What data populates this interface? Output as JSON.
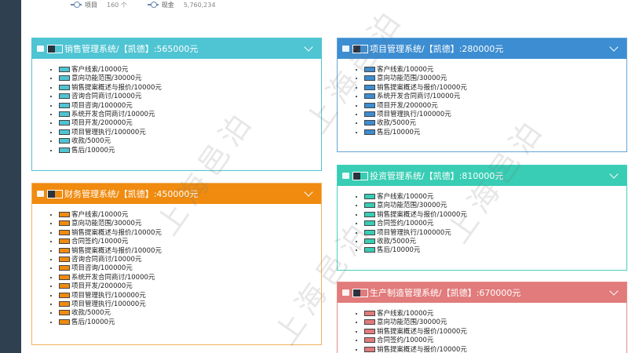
{
  "legend": [
    {
      "label": "项目",
      "value": "160 个"
    },
    {
      "label": "现金",
      "value": "5,760,234"
    }
  ],
  "panels": {
    "sales": {
      "title": "销售管理系统/【凯德】:565000元",
      "color": "#4fc4d3",
      "items": [
        "客户线索/10000元",
        "意向功能范围/30000元",
        "销售提案概述与报价/10000元",
        "咨询合同商讨/10000元",
        "项目咨询/100000元",
        "系统开发合同商讨/10000元",
        "项目开发/200000元",
        "项目管理执行/100000元",
        "收款/5000元",
        "售后/10000元"
      ]
    },
    "project": {
      "title": "项目管理系统/【凯德】:280000元",
      "color": "#3c8dd1",
      "items": [
        "客户线索/10000元",
        "意向功能范围/30000元",
        "销售提案概述与报价/10000元",
        "系统开发合同商讨/10000元",
        "项目开发/200000元",
        "项目管理执行/100000元",
        "收款/5000元",
        "售后/10000元"
      ]
    },
    "finance": {
      "title": "财务管理系统/【凯德】:450000元",
      "color": "#f08b0f",
      "items": [
        "客户线索/10000元",
        "意向功能范围/30000元",
        "销售提案概述与报价/10000元",
        "合同签约/10000元",
        "销售提案概述与报价/10000元",
        "咨询合同商讨/10000元",
        "项目咨询/100000元",
        "系统开发合同商讨/10000元",
        "项目开发/200000元",
        "项目管理执行/100000元",
        "项目管理执行/100000元",
        "收款/5000元",
        "售后/10000元"
      ]
    },
    "purchase": {
      "title": "投资管理系统/【凯德】:810000元",
      "color": "#38cdb4",
      "items": [
        "客户线索/10000元",
        "意向功能范围/30000元",
        "销售提案概述与报价/10000元",
        "合同签约/10000元",
        "项目管理执行/100000元",
        "收款/5000元",
        "售后/10000元"
      ]
    },
    "manufacturing": {
      "title": "生产制造管理系统/【凯德】:670000元",
      "color": "#e27b7b",
      "items": [
        "客户线索/10000元",
        "意向功能范围/30000元",
        "销售提案概述与报价/10000元",
        "合同签约/10000元",
        "销售提案概述与报价/10000元"
      ]
    }
  },
  "watermark": "上海邑泊"
}
